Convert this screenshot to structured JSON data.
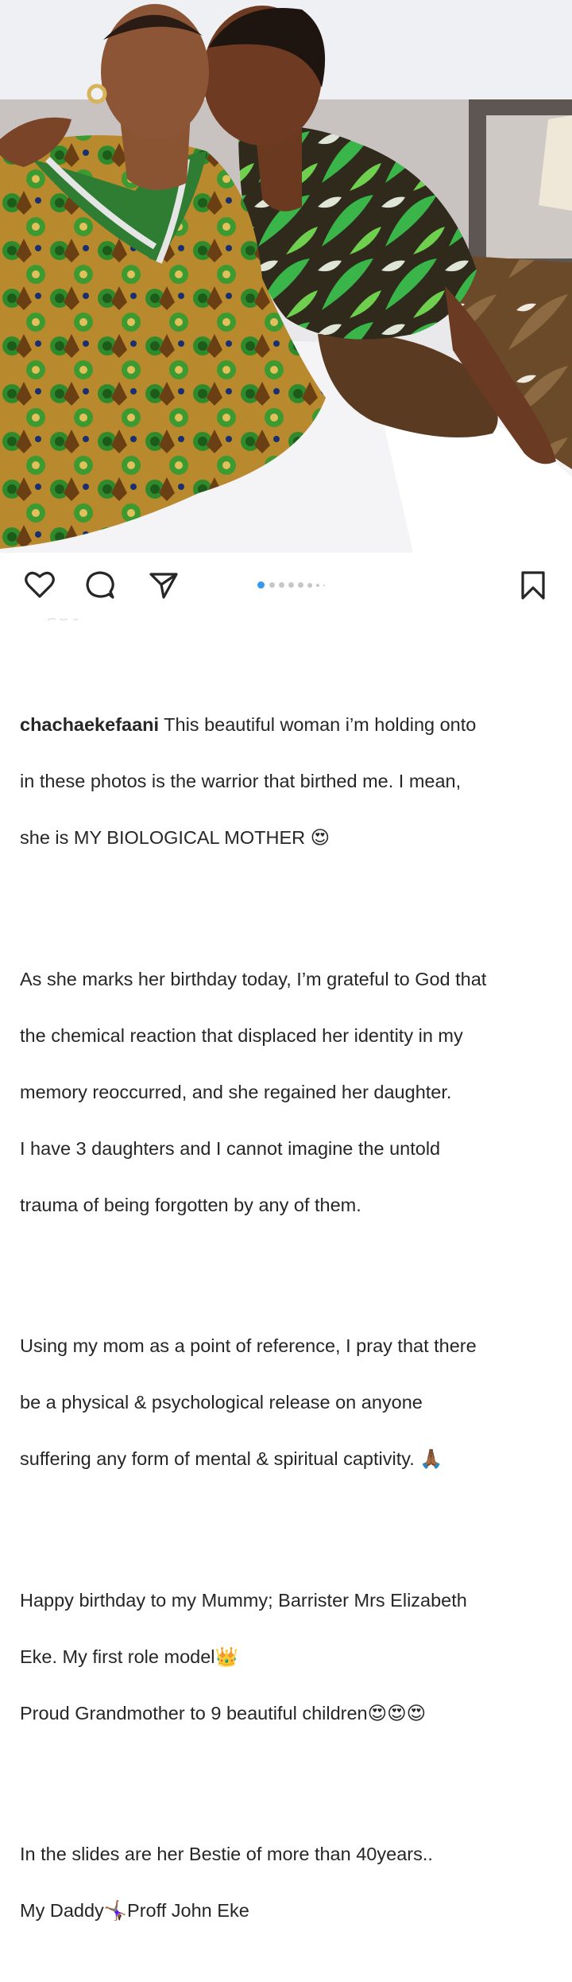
{
  "post": {
    "username": "chachaekefaani",
    "carousel": {
      "slides": 8,
      "active_index": 0
    },
    "actions": {
      "like_icon": "heart-icon",
      "comment_icon": "comment-bubble-icon",
      "share_icon": "paper-plane-icon",
      "save_icon": "bookmark-icon"
    },
    "caption": {
      "p1": [
        "This beautiful woman i’m holding onto",
        "in these photos is the warrior that birthed me. I mean,",
        "she is MY BIOLOGICAL MOTHER 😍"
      ],
      "p2": [
        "As she marks her birthday today, I’m grateful to God that",
        "the chemical reaction that displaced her identity in my",
        "memory reoccurred, and she regained her daughter.",
        "I have 3 daughters and I cannot imagine the untold",
        "trauma of being forgotten by any of them."
      ],
      "p3": [
        "Using my mom as a point of reference, I pray that there",
        "be a physical & psychological release on anyone",
        "suffering any form of mental & spiritual captivity. 🙏🏾"
      ],
      "p4": [
        "Happy birthday to my Mummy; Barrister Mrs Elizabeth",
        "Eke. My first role model👑",
        "Proud Grandmother to 9 beautiful children😍😍😍"
      ],
      "p5": [
        "In the slides are her Bestie of more than 40years..",
        "My Daddy🤸🏾‍♀️Proff John Eke"
      ]
    }
  },
  "colors": {
    "accent_dot": "#3897f0",
    "inactive_dot": "#c7c7c7",
    "text": "#262626"
  }
}
